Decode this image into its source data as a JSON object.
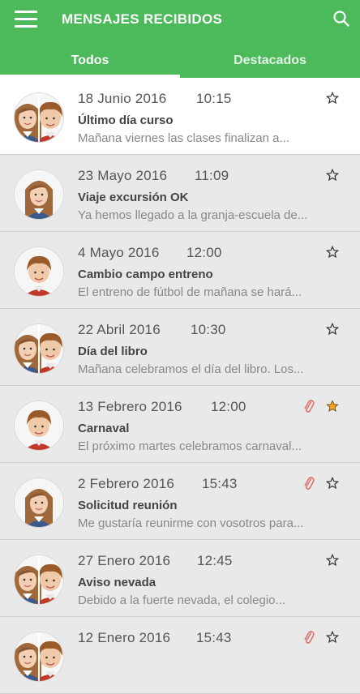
{
  "header": {
    "title": "MENSAJES RECIBIDOS",
    "menu_icon": "hamburger-menu-icon",
    "search_icon": "search-icon",
    "bg_color": "#4cba5a"
  },
  "tabs": [
    {
      "label": "Todos",
      "active": true
    },
    {
      "label": "Destacados",
      "active": false
    }
  ],
  "messages": [
    {
      "date": "18 Junio 2016",
      "time": "10:15",
      "subject": "Último día curso",
      "preview": "Mañana viernes las clases finalizan a...",
      "avatar": "girl-boy",
      "starred": false,
      "attachment": false
    },
    {
      "date": "23 Mayo 2016",
      "time": "11:09",
      "subject": "Viaje excursión OK",
      "preview": "Ya hemos llegado a la granja-escuela de...",
      "avatar": "girl",
      "starred": false,
      "attachment": false
    },
    {
      "date": "4 Mayo 2016",
      "time": "12:00",
      "subject": "Cambio campo entreno",
      "preview": "El entreno de fútbol de mañana se hará...",
      "avatar": "boy",
      "starred": false,
      "attachment": false
    },
    {
      "date": "22 Abril 2016",
      "time": "10:30",
      "subject": "Día del libro",
      "preview": "Mañana celebramos el día del libro. Los...",
      "avatar": "girl-boy",
      "starred": false,
      "attachment": false
    },
    {
      "date": "13 Febrero 2016",
      "time": "12:00",
      "subject": "Carnaval",
      "preview": "El próximo martes celebramos carnaval...",
      "avatar": "boy",
      "starred": true,
      "attachment": true
    },
    {
      "date": "2 Febrero 2016",
      "time": "15:43",
      "subject": "Solicitud reunión",
      "preview": "Me gustaría reunirme con vosotros para...",
      "avatar": "girl",
      "starred": false,
      "attachment": true
    },
    {
      "date": "27 Enero 2016",
      "time": "12:45",
      "subject": "Aviso nevada",
      "preview": "Debido a la fuerte nevada, el colegio...",
      "avatar": "girl-boy",
      "starred": false,
      "attachment": false
    },
    {
      "date": "12 Enero 2016",
      "time": "15:43",
      "subject": "",
      "preview": "",
      "avatar": "girl-boy",
      "starred": false,
      "attachment": true
    }
  ],
  "colors": {
    "star_filled": "#f5a623",
    "attachment": "#e06a6a"
  }
}
